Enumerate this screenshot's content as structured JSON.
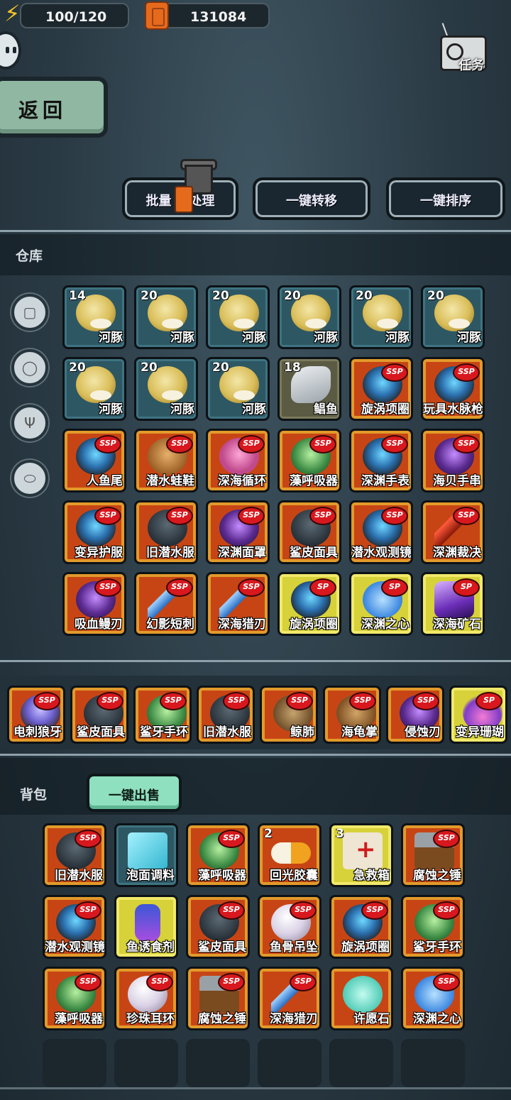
{
  "topbar": {
    "energy": "100/120",
    "fuel": "131084"
  },
  "nav": {
    "back_label": "返回",
    "task_label": "任务"
  },
  "actions": {
    "batch_prefix": "批量",
    "batch_suffix": "处理",
    "transfer": "一键转移",
    "sort": "一键排序"
  },
  "warehouse": {
    "title": "仓库",
    "categories": [
      "cube-icon",
      "can-icon",
      "trident-icon",
      "capsule-icon"
    ],
    "items": [
      {
        "count": "14",
        "name": "河豚",
        "rarity": "normal",
        "art": "fish"
      },
      {
        "count": "20",
        "name": "河豚",
        "rarity": "normal",
        "art": "fish"
      },
      {
        "count": "20",
        "name": "河豚",
        "rarity": "normal",
        "art": "fish"
      },
      {
        "count": "20",
        "name": "河豚",
        "rarity": "normal",
        "art": "fish"
      },
      {
        "count": "20",
        "name": "河豚",
        "rarity": "normal",
        "art": "fish"
      },
      {
        "count": "20",
        "name": "河豚",
        "rarity": "normal",
        "art": "fish"
      },
      {
        "count": "20",
        "name": "河豚",
        "rarity": "normal",
        "art": "fish"
      },
      {
        "count": "20",
        "name": "河豚",
        "rarity": "normal",
        "art": "fish"
      },
      {
        "count": "20",
        "name": "河豚",
        "rarity": "normal",
        "art": "fish"
      },
      {
        "count": "18",
        "name": "鲳鱼",
        "rarity": "grey",
        "art": "pomfret"
      },
      {
        "count": "",
        "name": "旋涡项圈",
        "rarity": "ssp",
        "art": "gear",
        "badge": "SSP"
      },
      {
        "count": "",
        "name": "玩具水脉枪",
        "rarity": "ssp",
        "art": "gear",
        "badge": "SSP"
      },
      {
        "count": "",
        "name": "人鱼尾",
        "rarity": "ssp",
        "art": "gear",
        "badge": "SSP"
      },
      {
        "count": "",
        "name": "潜水蛙鞋",
        "rarity": "ssp",
        "art": "tan",
        "badge": "SSP"
      },
      {
        "count": "",
        "name": "深海循环",
        "rarity": "ssp",
        "art": "pink",
        "badge": "SSP"
      },
      {
        "count": "",
        "name": "藻呼吸器",
        "rarity": "ssp",
        "art": "green",
        "badge": "SSP"
      },
      {
        "count": "",
        "name": "深渊手表",
        "rarity": "ssp",
        "art": "gear",
        "badge": "SSP"
      },
      {
        "count": "",
        "name": "海贝手串",
        "rarity": "ssp",
        "art": "purple",
        "badge": "SSP"
      },
      {
        "count": "",
        "name": "变异护服",
        "rarity": "ssp",
        "art": "gear",
        "badge": "SSP"
      },
      {
        "count": "",
        "name": "旧潜水服",
        "rarity": "ssp",
        "art": "dark",
        "badge": "SSP"
      },
      {
        "count": "",
        "name": "深渊面罩",
        "rarity": "ssp",
        "art": "purple",
        "badge": "SSP"
      },
      {
        "count": "",
        "name": "鲨皮面具",
        "rarity": "ssp",
        "art": "dark",
        "badge": "SSP"
      },
      {
        "count": "",
        "name": "潜水观测镜",
        "rarity": "ssp",
        "art": "gear",
        "badge": "SSP"
      },
      {
        "count": "",
        "name": "深渊裁决",
        "rarity": "ssp",
        "art": "redblade",
        "badge": "SSP"
      },
      {
        "count": "",
        "name": "吸血鳗刃",
        "rarity": "ssp",
        "art": "purple",
        "badge": "SSP"
      },
      {
        "count": "",
        "name": "幻影短刺",
        "rarity": "ssp",
        "art": "blade",
        "badge": "SSP"
      },
      {
        "count": "",
        "name": "深海猎刃",
        "rarity": "ssp",
        "art": "blade",
        "badge": "SSP"
      },
      {
        "count": "",
        "name": "旋涡项圈",
        "rarity": "sp",
        "art": "gear",
        "badge": "SP"
      },
      {
        "count": "",
        "name": "深渊之心",
        "rarity": "sp",
        "art": "heart",
        "badge": "SP"
      },
      {
        "count": "",
        "name": "深海矿石",
        "rarity": "sp",
        "art": "gem",
        "badge": "SP"
      }
    ]
  },
  "equipped": [
    {
      "name": "电刺狼牙",
      "rarity": "ssp",
      "art": "mace",
      "badge": "SSP"
    },
    {
      "name": "鲨皮面具",
      "rarity": "ssp",
      "art": "dark",
      "badge": "SSP"
    },
    {
      "name": "鲨牙手环",
      "rarity": "ssp",
      "art": "green",
      "badge": "SSP"
    },
    {
      "name": "旧潜水服",
      "rarity": "ssp",
      "art": "dark",
      "badge": "SSP"
    },
    {
      "name": "鲸肺",
      "rarity": "ssp",
      "art": "lung",
      "badge": "SSP"
    },
    {
      "name": "海龟掌",
      "rarity": "ssp",
      "art": "claw",
      "badge": "SSP"
    },
    {
      "name": "侵蚀刃",
      "rarity": "ssp",
      "art": "purple",
      "badge": "SSP"
    },
    {
      "name": "变异珊瑚",
      "rarity": "sp",
      "art": "coral",
      "badge": "SP"
    }
  ],
  "backpack": {
    "title": "背包",
    "sell_label": "一键出售",
    "items": [
      {
        "count": "",
        "name": "旧潜水服",
        "rarity": "ssp",
        "art": "dark",
        "badge": "SSP"
      },
      {
        "count": "",
        "name": "泡面调料",
        "rarity": "normal",
        "art": "packet"
      },
      {
        "count": "",
        "name": "藻呼吸器",
        "rarity": "ssp",
        "art": "green",
        "badge": "SSP"
      },
      {
        "count": "2",
        "name": "回光胶囊",
        "rarity": "ssp",
        "art": "pill"
      },
      {
        "count": "3",
        "name": "急救箱",
        "rarity": "sp",
        "art": "kit"
      },
      {
        "count": "",
        "name": "腐蚀之锤",
        "rarity": "ssp",
        "art": "hammer",
        "badge": "SSP"
      },
      {
        "count": "",
        "name": "潜水观测镜",
        "rarity": "ssp",
        "art": "gear",
        "badge": "SSP"
      },
      {
        "count": "",
        "name": "鱼诱食剂",
        "rarity": "sp",
        "art": "bottle"
      },
      {
        "count": "",
        "name": "鲨皮面具",
        "rarity": "ssp",
        "art": "dark",
        "badge": "SSP"
      },
      {
        "count": "",
        "name": "鱼骨吊坠",
        "rarity": "ssp",
        "art": "pearl",
        "badge": "SSP"
      },
      {
        "count": "",
        "name": "旋涡项圈",
        "rarity": "ssp",
        "art": "gear",
        "badge": "SSP"
      },
      {
        "count": "",
        "name": "鲨牙手环",
        "rarity": "ssp",
        "art": "green",
        "badge": "SSP"
      },
      {
        "count": "",
        "name": "藻呼吸器",
        "rarity": "ssp",
        "art": "green",
        "badge": "SSP"
      },
      {
        "count": "",
        "name": "珍珠耳环",
        "rarity": "ssp",
        "art": "pearl",
        "badge": "SSP"
      },
      {
        "count": "",
        "name": "腐蚀之锤",
        "rarity": "ssp",
        "art": "hammer",
        "badge": "SSP"
      },
      {
        "count": "",
        "name": "深海猎刃",
        "rarity": "ssp",
        "art": "blade",
        "badge": "SSP"
      },
      {
        "count": "",
        "name": "许愿石",
        "rarity": "ssp",
        "art": "whale"
      },
      {
        "count": "",
        "name": "深渊之心",
        "rarity": "ssp",
        "art": "heart",
        "badge": "SSP"
      }
    ],
    "empty_slots": 6
  }
}
